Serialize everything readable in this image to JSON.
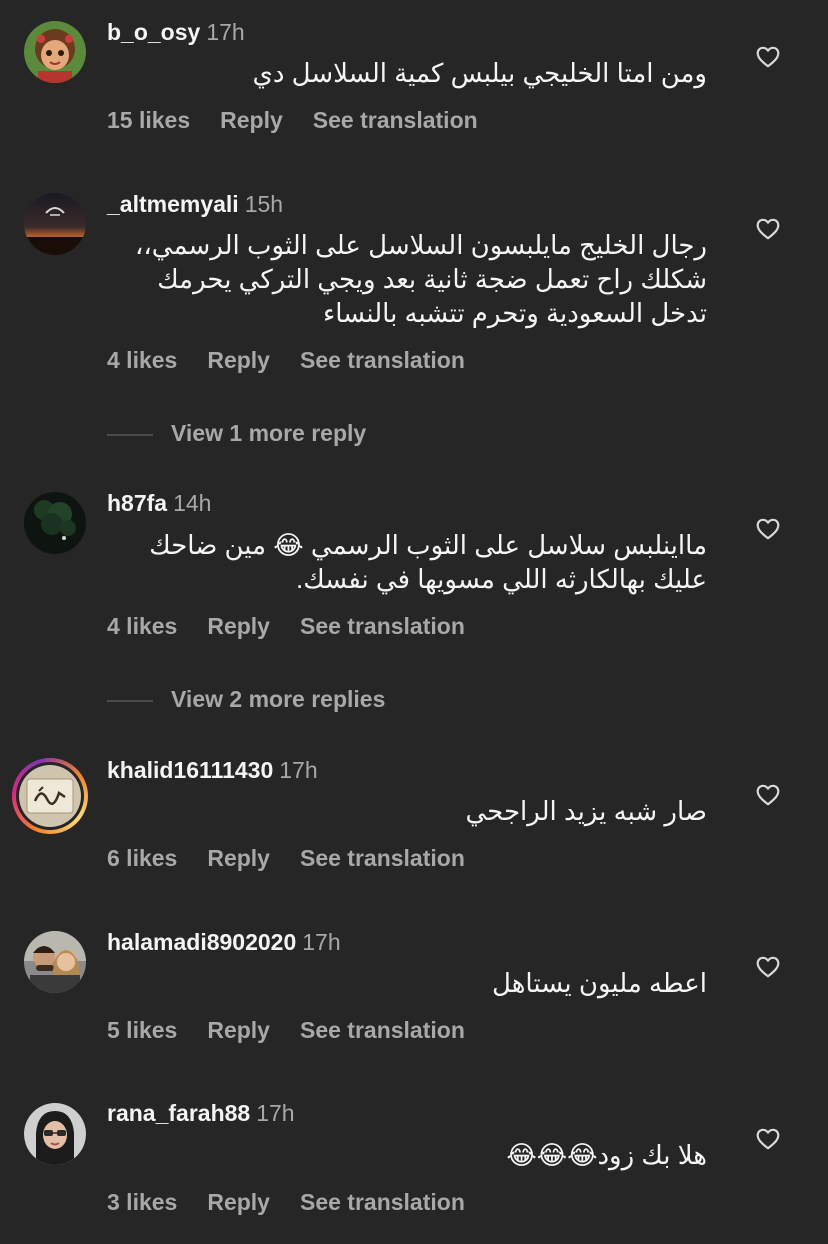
{
  "comments": [
    {
      "username": "b_o_osy",
      "time": "17h",
      "lines": [
        "ومن امتا الخليجي بيلبس كمية السلاسل دي"
      ],
      "likes": "15 likes",
      "reply": "Reply",
      "translate": "See translation",
      "avatar": "cartoon-girl-avatar"
    },
    {
      "username": "_altmemyali",
      "time": "15h",
      "lines": [
        "رجال الخليج مايلبسون السلاسل على الثوب الرسمي،،",
        "شكلك راح تعمل ضجة ثانية بعد ويجي التركي  يحرمك",
        "تدخل السعودية وتحرم تتشبه بالنساء"
      ],
      "likes": "4 likes",
      "reply": "Reply",
      "translate": "See translation",
      "view_more": "View 1 more reply",
      "avatar": "sunset-avatar"
    },
    {
      "username": "h87fa",
      "time": "14h",
      "lines": [
        "مااينلبس سلاسل على الثوب الرسمي 😂 مين ضاحك",
        "عليك بهالكارثه اللي مسويها في نفسك."
      ],
      "likes": "4 likes",
      "reply": "Reply",
      "translate": "See translation",
      "view_more": "View 2 more replies",
      "avatar": "night-tree-avatar"
    },
    {
      "username": "khalid16111430",
      "time": "17h",
      "lines": [
        "صار شبه يزيد الراجحي"
      ],
      "likes": "6 likes",
      "reply": "Reply",
      "translate": "See translation",
      "avatar": "calligraphy-avatar"
    },
    {
      "username": "halamadi8902020",
      "time": "17h",
      "lines": [
        "اعطه مليون يستاهل"
      ],
      "likes": "5 likes",
      "reply": "Reply",
      "translate": "See translation",
      "avatar": "couple-avatar"
    },
    {
      "username": "rana_farah88",
      "time": "17h",
      "lines": [
        "هلا بك زود😂😂😂"
      ],
      "likes": "3 likes",
      "reply": "Reply",
      "translate": "See translation",
      "avatar": "woman-glasses-avatar"
    }
  ],
  "icons": {
    "like": "heart-outline-icon"
  },
  "colors": {
    "background": "#262626",
    "primary_text": "#f5f5f5",
    "secondary_text": "#a8a8a8"
  }
}
